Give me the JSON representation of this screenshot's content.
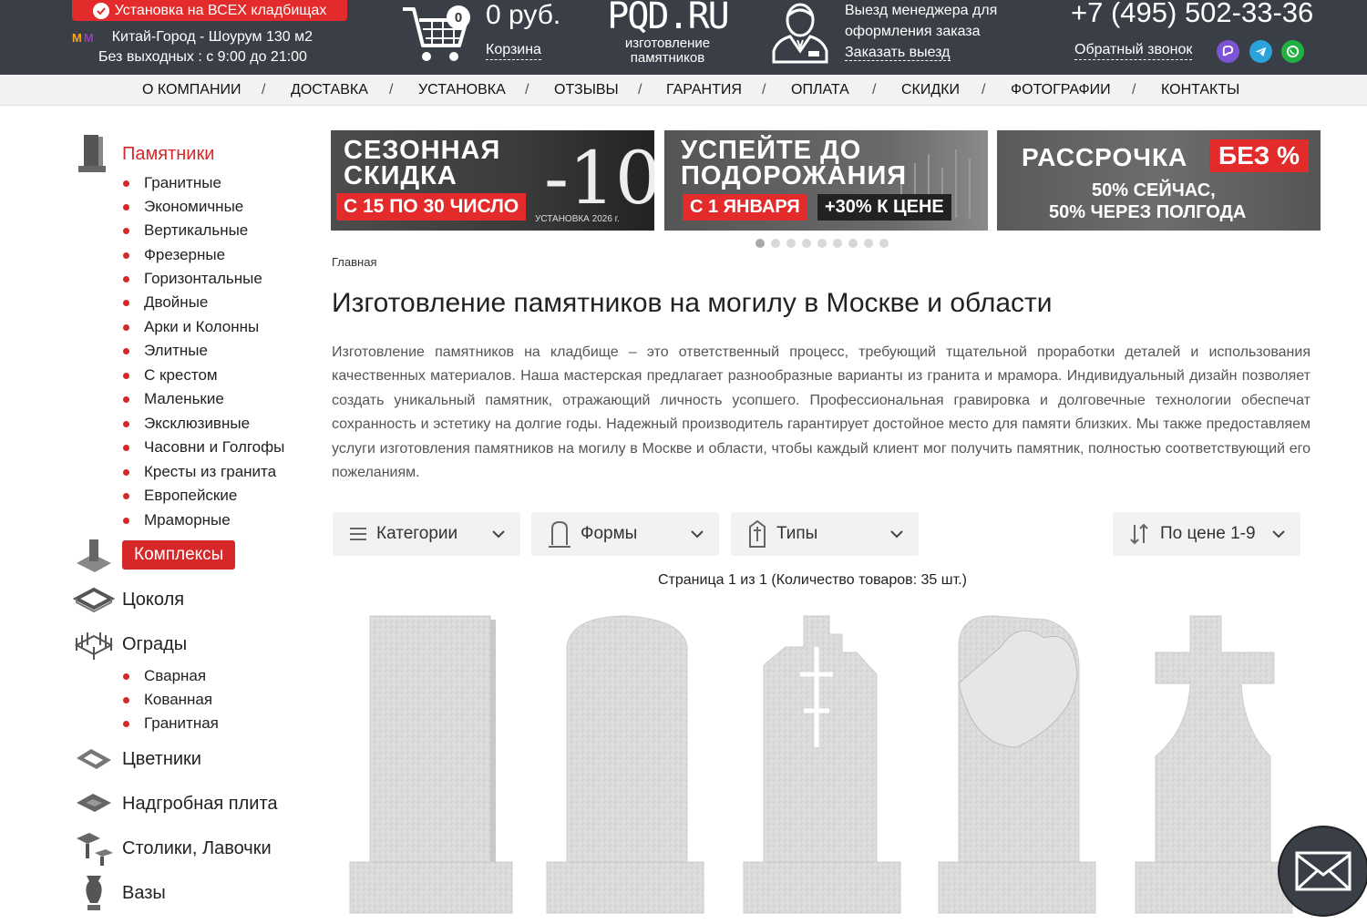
{
  "header": {
    "promo": "Установка на ВСЕХ кладбищах",
    "showroom": "Китай-Город - Шоурум 130 м2",
    "hours": "Без выходных : с 9:00 до 21:00",
    "cart_count": "0",
    "cart_sum": "0 руб.",
    "cart_label": "Корзина",
    "logo": "PQD.RU",
    "logo_sub1": "изготовление",
    "logo_sub2": "памятников",
    "manager_line1": "Выезд менеджера для",
    "manager_line2": "оформления заказа",
    "manager_link": "Заказать выезд",
    "phone": "+7 (495) 502-33-36",
    "callback": "Обратный звонок"
  },
  "nav": {
    "items": [
      "О КОМПАНИИ",
      "ДОСТАВКА",
      "УСТАНОВКА",
      "ОТЗЫВЫ",
      "ГАРАНТИЯ",
      "ОПЛАТА",
      "СКИДКИ",
      "ФОТОГРАФИИ",
      "КОНТАКТЫ"
    ],
    "separator": "/"
  },
  "sidebar": {
    "monuments": "Памятники",
    "monument_types": [
      "Гранитные",
      "Экономичные",
      "Вертикальные",
      "Фрезерные",
      "Горизонтальные",
      "Двойные",
      "Арки и Колонны",
      "Элитные",
      "С крестом",
      "Маленькие",
      "Эксклюзивные",
      "Часовни и Голгофы",
      "Кресты из гранита",
      "Европейские",
      "Мраморные"
    ],
    "complexes": "Комплексы",
    "plinths": "Цоколя",
    "fences": "Ограды",
    "fence_types": [
      "Сварная",
      "Кованная",
      "Гранитная"
    ],
    "flowerbeds": "Цветники",
    "gravestone": "Надгробная плита",
    "tables": "Столики, Лавочки",
    "vases": "Вазы"
  },
  "banners": {
    "b1_title1": "СЕЗОННАЯ",
    "b1_title2": "СКИДКА",
    "b1_red": "С 15 ПО 30 ЧИСЛО",
    "b1_big": "-10",
    "b1_percent": "%",
    "b1_small": "УСТАНОВКА 2026 г.",
    "b2_title1": "УСПЕЙТЕ ДО",
    "b2_title2": "ПОДОРОЖАНИЯ",
    "b2_red": "С 1 ЯНВАРЯ",
    "b2_black": "+30% К ЦЕНЕ",
    "b3_title": "РАССРОЧКА",
    "b3_red": "БЕЗ %",
    "b3_line1": "50% СЕЙЧАС,",
    "b3_line2": "50% ЧЕРЕЗ ПОЛГОДА"
  },
  "main": {
    "breadcrumb": "Главная",
    "title": "Изготовление памятников на могилу в Москве и области",
    "intro": "Изготовление памятников на кладбище – это ответственный процесс, требующий тщательной проработки деталей и использования качественных материалов. Наша мастерская предлагает разнообразные варианты из гранита и мрамора. Индивидуальный дизайн позволяет создать уникальный памятник, отражающий личность усопшего. Профессиональная гравировка и долговечные технологии обеспечат сохранность и эстетику на долгие годы. Надежный производитель гарантирует достойное место для памяти близких. Мы также предоставляем услуги изготовления памятников на могилу в Москве и области, чтобы каждый клиент мог получить памятник, полностью соответствующий его пожеланиям.",
    "filter_categories": "Категории",
    "filter_forms": "Формы",
    "filter_types": "Типы",
    "sort": "По цене 1-9",
    "page_info": "Страница 1 из 1 (Количество товаров: 35 шт.)"
  },
  "colors": {
    "header_bg": "#3a3f47",
    "accent_red": "#d62828",
    "nav_bg": "#f2f2f2"
  }
}
